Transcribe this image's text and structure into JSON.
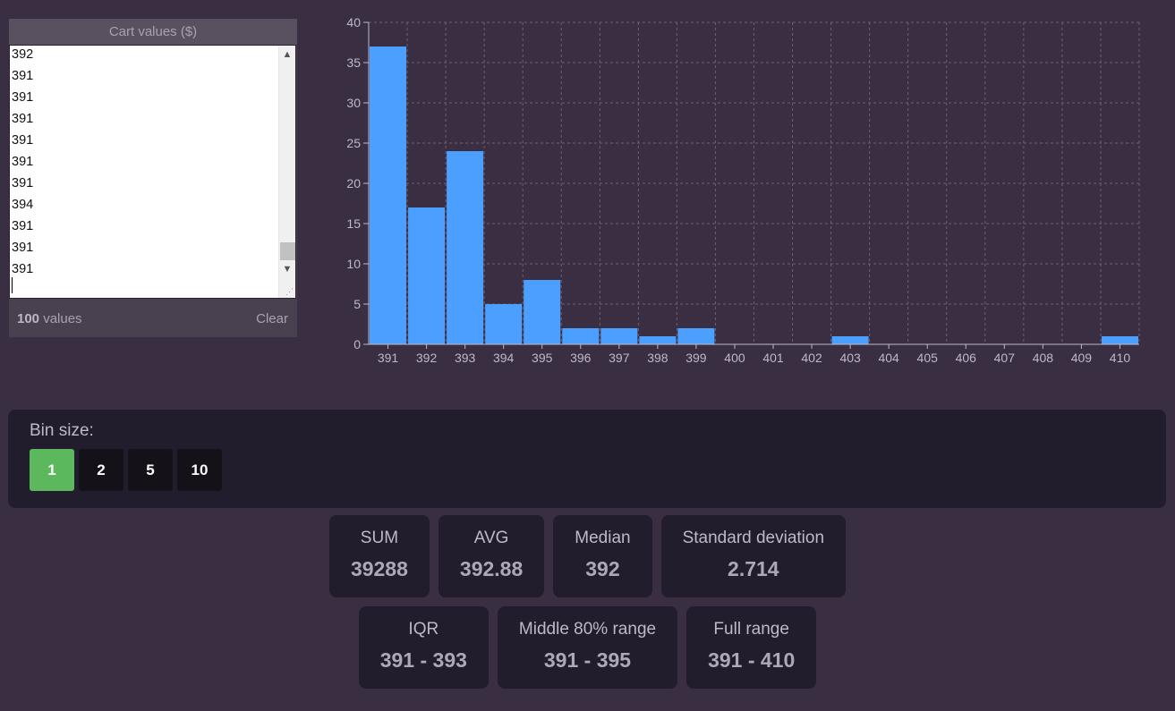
{
  "input": {
    "header": "Cart values ($)",
    "lines": [
      "392",
      "391",
      "391",
      "391",
      "391",
      "391",
      "391",
      "394",
      "391",
      "391",
      "391"
    ],
    "count_number": "100",
    "count_suffix": " values",
    "clear_label": "Clear"
  },
  "chart_data": {
    "type": "bar",
    "categories": [
      "391",
      "392",
      "393",
      "394",
      "395",
      "396",
      "397",
      "398",
      "399",
      "400",
      "401",
      "402",
      "403",
      "404",
      "405",
      "406",
      "407",
      "408",
      "409",
      "410"
    ],
    "values": [
      37,
      17,
      24,
      5,
      8,
      2,
      2,
      1,
      2,
      0,
      0,
      0,
      1,
      0,
      0,
      0,
      0,
      0,
      0,
      1
    ],
    "title": "",
    "xlabel": "",
    "ylabel": "",
    "ylim": [
      0,
      40
    ],
    "yticks": [
      0,
      5,
      10,
      15,
      20,
      25,
      30,
      35,
      40
    ],
    "grid": true,
    "bar_color": "#4a9fff"
  },
  "bin": {
    "label": "Bin size:",
    "options": [
      "1",
      "2",
      "5",
      "10"
    ],
    "selected": "1",
    "active_color": "#5cb85c"
  },
  "stats": {
    "sum": {
      "label": "SUM",
      "value": "39288"
    },
    "avg": {
      "label": "AVG",
      "value": "392.88"
    },
    "median": {
      "label": "Median",
      "value": "392"
    },
    "std": {
      "label": "Standard deviation",
      "value": "2.714"
    },
    "iqr": {
      "label": "IQR",
      "value": "391 - 393"
    },
    "mid80": {
      "label": "Middle 80% range",
      "value": "391 - 395"
    },
    "full": {
      "label": "Full range",
      "value": "391 - 410"
    }
  }
}
